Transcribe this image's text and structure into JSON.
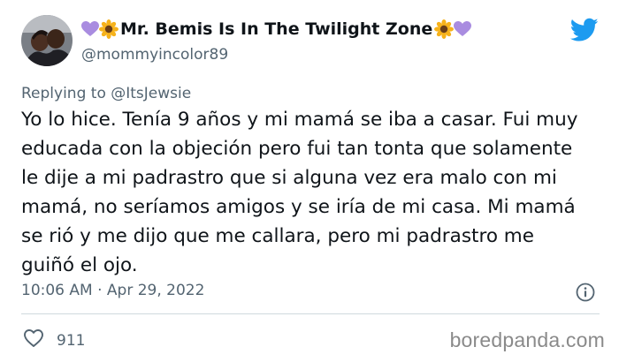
{
  "author": {
    "emoji_left": [
      "purple-heart-icon",
      "sunflower-icon"
    ],
    "display_name": "Mr. Bemis Is In The Twilight Zone",
    "emoji_right": [
      "sunflower-icon",
      "purple-heart-icon"
    ],
    "handle": "@mommyincolor89"
  },
  "reply": {
    "prefix": "Replying to",
    "user": "@ItsJewsie"
  },
  "tweet": {
    "text": "Yo lo hice. Tenía 9 años y mi mamá se iba a casar. Fui muy educada con la objeción pero fui tan tonta que solamente le dije a mi padrastro que si alguna vez era malo con mi mamá, no seríamos amigos y se iría de mi casa. Mi mamá se rió y me dijo que me callara, pero mi padrastro me guiñó el ojo.",
    "timestamp": "10:06 AM · Apr 29, 2022"
  },
  "engagement": {
    "likes": "911"
  },
  "watermark": "boredpanda.com",
  "colors": {
    "twitter_blue": "#1d9bf0",
    "secondary_text": "#536471",
    "purple_heart": "#a98ce0",
    "sunflower_petal": "#f6b21b"
  }
}
